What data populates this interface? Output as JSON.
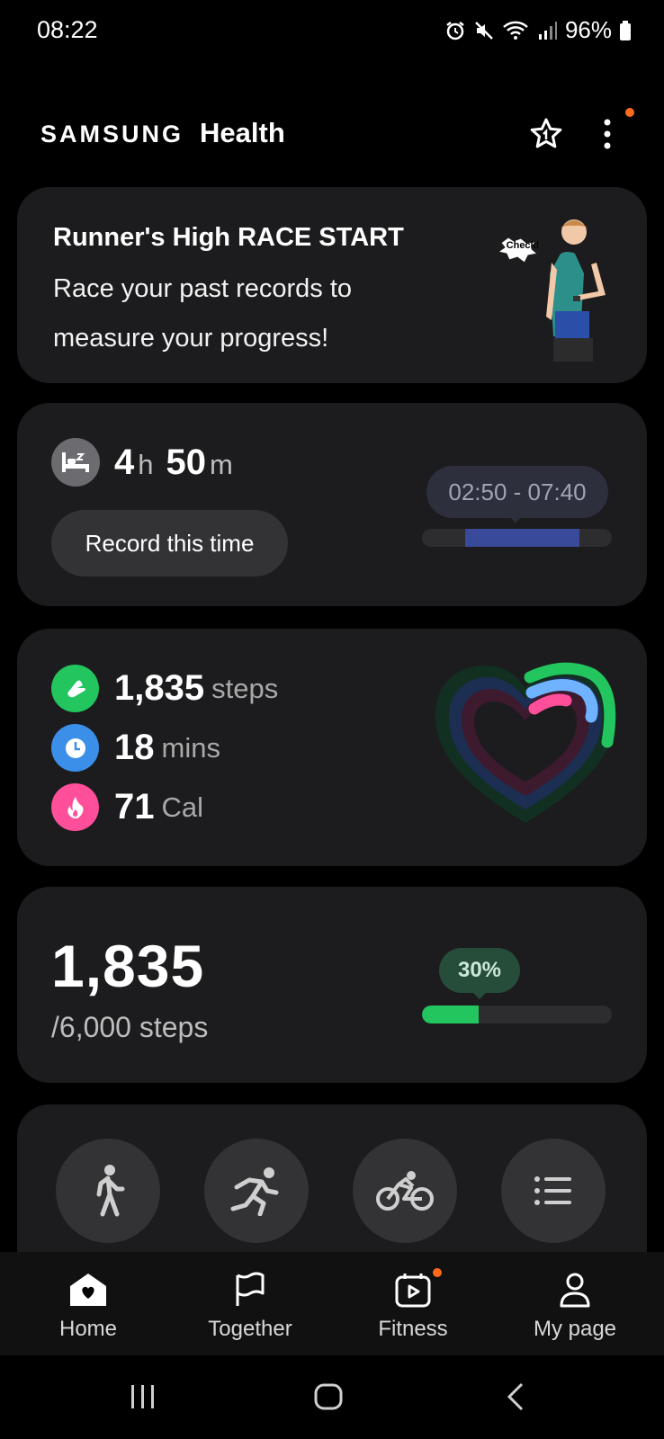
{
  "status_bar": {
    "time": "08:22",
    "battery": "96%"
  },
  "header": {
    "brand_samsung": "SAMSUNG",
    "brand_health": "Health"
  },
  "promo": {
    "title": "Runner's High RACE START",
    "text": "Race your past records to measure your progress!",
    "bubble": "Check!"
  },
  "sleep": {
    "hours": "4",
    "hours_unit": "h",
    "minutes": "50",
    "minutes_unit": "m",
    "record_label": "Record this time",
    "time_range": "02:50 - 07:40"
  },
  "activity": {
    "steps_value": "1,835",
    "steps_unit": "steps",
    "mins_value": "18",
    "mins_unit": "mins",
    "cal_value": "71",
    "cal_unit": "Cal",
    "colors": {
      "steps": "#22c55e",
      "mins": "#3b8fe8",
      "cal": "#ff4f9a"
    }
  },
  "steps": {
    "count": "1,835",
    "goal": "/6,000 steps",
    "percent_label": "30%",
    "progress_fraction": 0.3
  },
  "workouts": [
    {
      "name": "walking-icon"
    },
    {
      "name": "running-icon"
    },
    {
      "name": "cycling-icon"
    },
    {
      "name": "list-icon"
    }
  ],
  "bottom_nav": [
    {
      "label": "Home"
    },
    {
      "label": "Together"
    },
    {
      "label": "Fitness"
    },
    {
      "label": "My page"
    }
  ]
}
